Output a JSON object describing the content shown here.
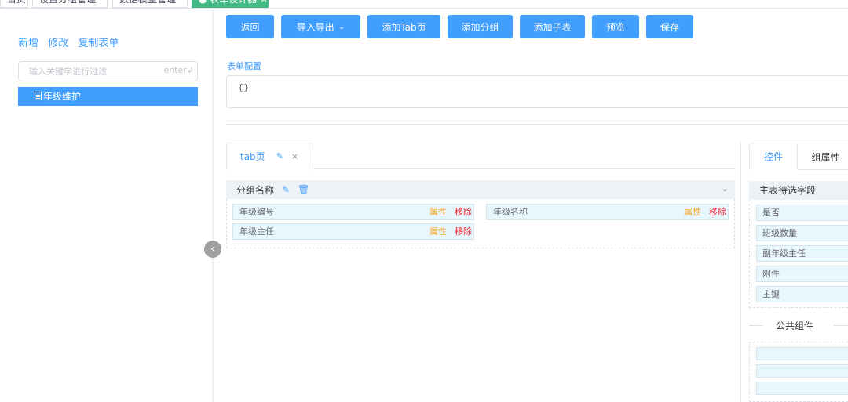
{
  "top_tabs": [
    {
      "label": "首页",
      "active": false
    },
    {
      "label": "设置分组管理",
      "active": false
    },
    {
      "label": "数据模型管理",
      "active": false
    },
    {
      "label": "● 表单设计器 ×",
      "active": true
    }
  ],
  "left_panel": {
    "actions": [
      "新增",
      "修改",
      "复制表单"
    ],
    "filter": {
      "placeholder": "输入关键字进行过滤",
      "value": "",
      "hint": "enter↲"
    },
    "tree": [
      {
        "label": "年级维护",
        "icon": "document-icon",
        "selected": true
      }
    ],
    "collapse_icon": "chevron-left-icon"
  },
  "toolbar": {
    "buttons": [
      {
        "label": "返回"
      },
      {
        "label": "导入导出",
        "dropdown": true
      },
      {
        "label": "添加Tab页"
      },
      {
        "label": "添加分组"
      },
      {
        "label": "添加子表"
      },
      {
        "label": "预览"
      },
      {
        "label": "保存"
      }
    ]
  },
  "form_config": {
    "label": "表单配置",
    "value": "{}"
  },
  "designer": {
    "tabs": [
      {
        "label": "tab页",
        "edit_icon": "pencil-icon",
        "close_icon": "close-icon"
      }
    ],
    "groups": [
      {
        "title": "分组名称",
        "fields": [
          {
            "label": "年级编号",
            "prop_label": "属性",
            "remove_label": "移除"
          },
          {
            "label": "年级名称",
            "prop_label": "属性",
            "remove_label": "移除"
          },
          {
            "label": "年级主任",
            "prop_label": "属性",
            "remove_label": "移除"
          }
        ]
      }
    ]
  },
  "right_panel": {
    "tabs": [
      {
        "label": "控件",
        "active": true
      },
      {
        "label": "组属性",
        "active": false
      }
    ],
    "main_fields_title": "主表待选字段",
    "main_fields": [
      "是否",
      "班级数量",
      "副年级主任",
      "附件",
      "主键"
    ],
    "public_title": "公共组件",
    "public_items": [
      "",
      "",
      ""
    ]
  },
  "colors": {
    "primary": "#409eff",
    "active_tab_green": "#42b983",
    "property_orange": "#f5a623",
    "remove_red": "#f01e2c",
    "field_bg": "#e8f7fd"
  }
}
